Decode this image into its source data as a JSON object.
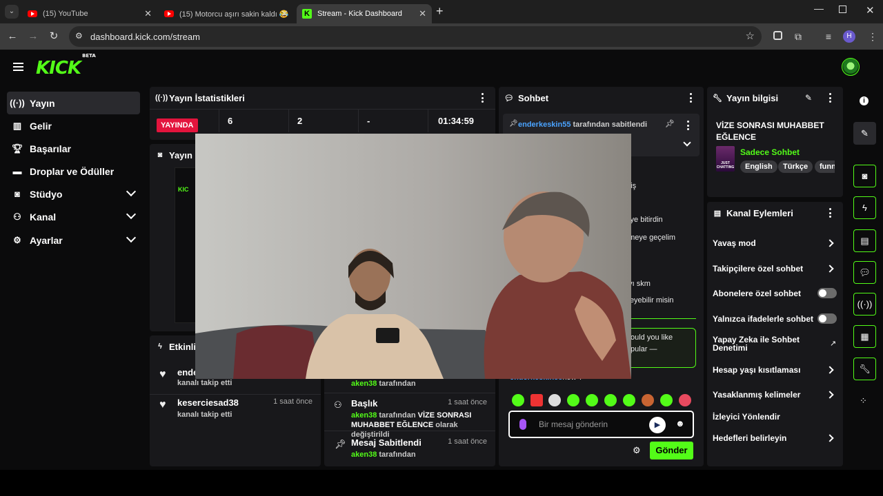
{
  "browser": {
    "tabs": [
      {
        "title": "(15) YouTube"
      },
      {
        "title": "(15) Motorcu aşırı sakin kaldı 😂"
      },
      {
        "title": "Stream - Kick Dashboard"
      }
    ],
    "url": "dashboard.kick.com/stream",
    "profile_initial": "H"
  },
  "app": {
    "logo": "KICK",
    "logo_badge": "BETA",
    "accent": "#53fc18"
  },
  "sidebar": {
    "items": [
      {
        "label": "Yayın",
        "icon": "broadcast-icon"
      },
      {
        "label": "Gelir",
        "icon": "revenue-icon"
      },
      {
        "label": "Başarılar",
        "icon": "trophy-icon"
      },
      {
        "label": "Droplar ve Ödüller",
        "icon": "gift-icon"
      },
      {
        "label": "Stüdyo",
        "icon": "studio-icon"
      },
      {
        "label": "Kanal",
        "icon": "channel-icon"
      },
      {
        "label": "Ayarlar",
        "icon": "settings-icon"
      }
    ]
  },
  "stats": {
    "title": "Yayın İstatistikleri",
    "live_label": "YAYINDA",
    "values": [
      "6",
      "2",
      "-",
      "01:34:59"
    ]
  },
  "preview": {
    "title": "Yayın Ö"
  },
  "activity": {
    "title": "Etkinlik",
    "left": [
      {
        "user": "ende",
        "sub": "kanalı takip etti",
        "time": ""
      },
      {
        "user": "keserciesad38",
        "sub": "kanalı takip etti",
        "time": "1 saat önce"
      }
    ],
    "right": [
      {
        "title": "",
        "actor": "aken38",
        "sub": "tarafından",
        "extra": "",
        "time": ""
      },
      {
        "title": "Başlık",
        "actor": "aken38",
        "sub": "tarafından",
        "bold_value": "VİZE SONRASI MUHABBET EĞLENCE",
        "extra": "olarak değiştirildi",
        "time": "1 saat önce"
      },
      {
        "title": "Mesaj Sabitlendi",
        "actor": "aken38",
        "sub": "tarafından",
        "extra": "",
        "time": "1 saat önce"
      }
    ]
  },
  "chat": {
    "title": "Sohbet",
    "pinned_by": "enderkeskin55",
    "pinned_suffix": "tarafından sabitlendi",
    "visible_fragments": [
      "miş",
      "niye bitirdin",
      "emeye geçelim",
      "ayı skm",
      "yleyebilir misin"
    ],
    "bot_fragments": [
      "ould you like",
      "pular —"
    ],
    "last_line_user": "enderkeskin55",
    "last_line_text": "how ?",
    "input_placeholder": "Bir mesaj gönderin",
    "send_label": "Gönder"
  },
  "stream_info": {
    "title": "Yayın bilgisi",
    "stream_title": "VİZE SONRASI MUHABBET EĞLENCE",
    "category": "Sadece Sohbet",
    "category_thumb_text": "JUST CHATTING",
    "tags": [
      "English",
      "Türkçe",
      "funn"
    ]
  },
  "channel_actions": {
    "title": "Kanal Eylemleri",
    "items": [
      {
        "label": "Yavaş mod",
        "control": "arrow"
      },
      {
        "label": "Takipçilere özel sohbet",
        "control": "arrow"
      },
      {
        "label": "Abonelere özel sohbet",
        "control": "toggle"
      },
      {
        "label": "Yalnızca ifadelerle sohbet",
        "control": "toggle"
      },
      {
        "label": "Yapay Zeka ile Sohbet Denetimi",
        "control": "external"
      },
      {
        "label": "Hesap yaşı kısıtlaması",
        "control": "arrow"
      },
      {
        "label": "Yasaklanmış kelimeler",
        "control": "arrow"
      },
      {
        "label": "İzleyici Yönlendir",
        "control": "none"
      },
      {
        "label": "Hedefleri belirleyin",
        "control": "arrow"
      }
    ]
  }
}
